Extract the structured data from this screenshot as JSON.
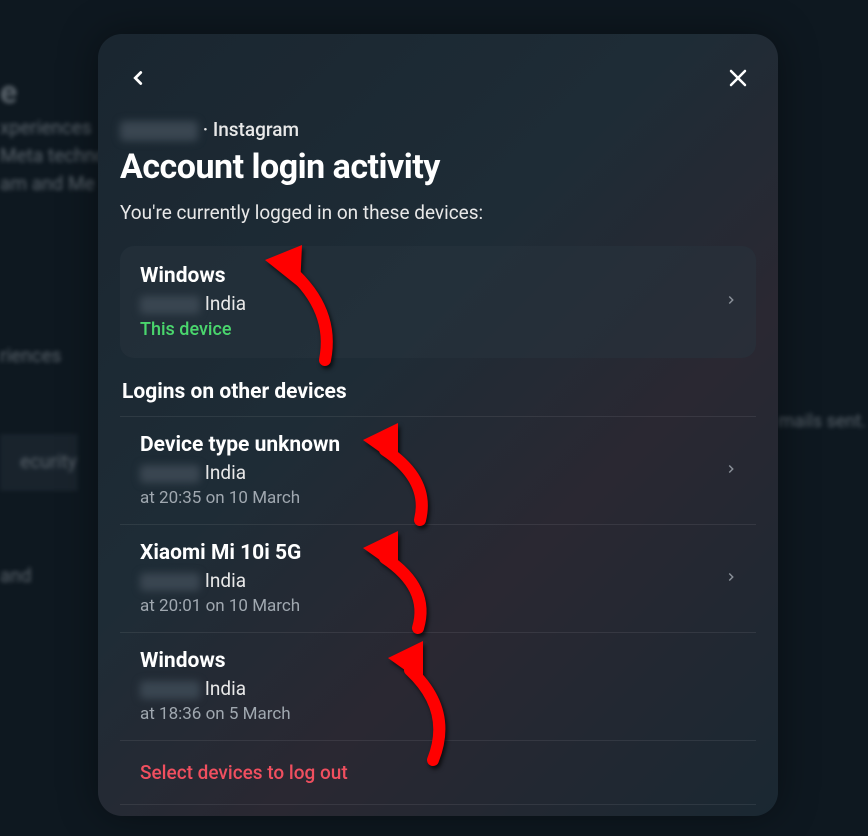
{
  "background": {
    "title_fragment": "e",
    "line1": "xperiences",
    "line2": "Meta techno",
    "line3": "am and Me",
    "sidebar_item1": "riences",
    "sidebar_item2": "ecurity",
    "sidebar_item3": "and",
    "right_fragment": "mails sent."
  },
  "modal": {
    "account_suffix": " · Instagram",
    "title": "Account login activity",
    "subtitle": "You're currently logged in on these devices:",
    "current_device": {
      "name": "Windows",
      "location_suffix": " India",
      "this_device": "This device"
    },
    "other_header": "Logins on other devices",
    "devices": [
      {
        "name": "Device type unknown",
        "location_suffix": " India",
        "time": "at 20:35 on 10 March"
      },
      {
        "name": "Xiaomi Mi 10i 5G",
        "location_suffix": " India",
        "time": "at 20:01 on 10 March"
      },
      {
        "name": "Windows",
        "location_suffix": " India",
        "time": "at 18:36 on 5 March"
      }
    ],
    "logout_action": "Select devices to log out"
  }
}
